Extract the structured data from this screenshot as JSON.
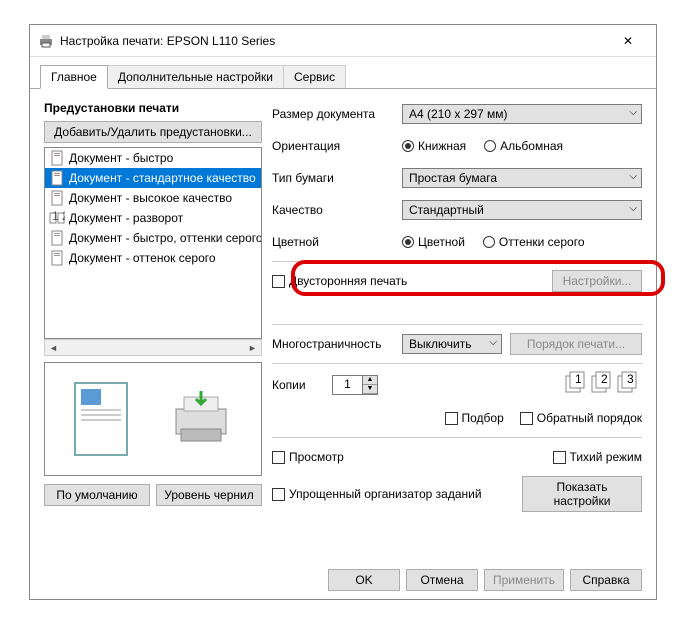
{
  "window": {
    "title": "Настройка печати: EPSON L110 Series",
    "close": "✕"
  },
  "tabs": {
    "main": "Главное",
    "advanced": "Дополнительные настройки",
    "service": "Сервис"
  },
  "left": {
    "header": "Предустановки печати",
    "add_remove": "Добавить/Удалить предустановки...",
    "presets": [
      "Документ - быстро",
      "Документ - стандартное качество",
      "Документ - высокое качество",
      "Документ - разворот",
      "Документ - быстро, оттенки серого",
      "Документ - оттенок серого"
    ],
    "default_btn": "По умолчанию",
    "ink_btn": "Уровень чернил"
  },
  "right": {
    "doc_size_label": "Размер документа",
    "doc_size_value": "A4 (210 x 297 мм)",
    "orientation_label": "Ориентация",
    "orientation_portrait": "Книжная",
    "orientation_landscape": "Альбомная",
    "paper_type_label": "Тип бумаги",
    "paper_type_value": "Простая бумага",
    "quality_label": "Качество",
    "quality_value": "Стандартный",
    "color_label": "Цветной",
    "color_color": "Цветной",
    "color_gray": "Оттенки серого",
    "duplex_label": "Двусторонняя печать",
    "settings_btn": "Настройки...",
    "multipage_label": "Многостраничность",
    "multipage_value": "Выключить",
    "page_order_btn": "Порядок печати...",
    "copies_label": "Копии",
    "copies_value": "1",
    "collate_label": "Подбор",
    "reverse_label": "Обратный порядок",
    "preview_label": "Просмотр",
    "quiet_label": "Тихий режим",
    "organizer_label": "Упрощенный организатор заданий",
    "show_settings_btn": "Показать настройки"
  },
  "dialog": {
    "ok": "OK",
    "cancel": "Отмена",
    "apply": "Применить",
    "help": "Справка"
  }
}
